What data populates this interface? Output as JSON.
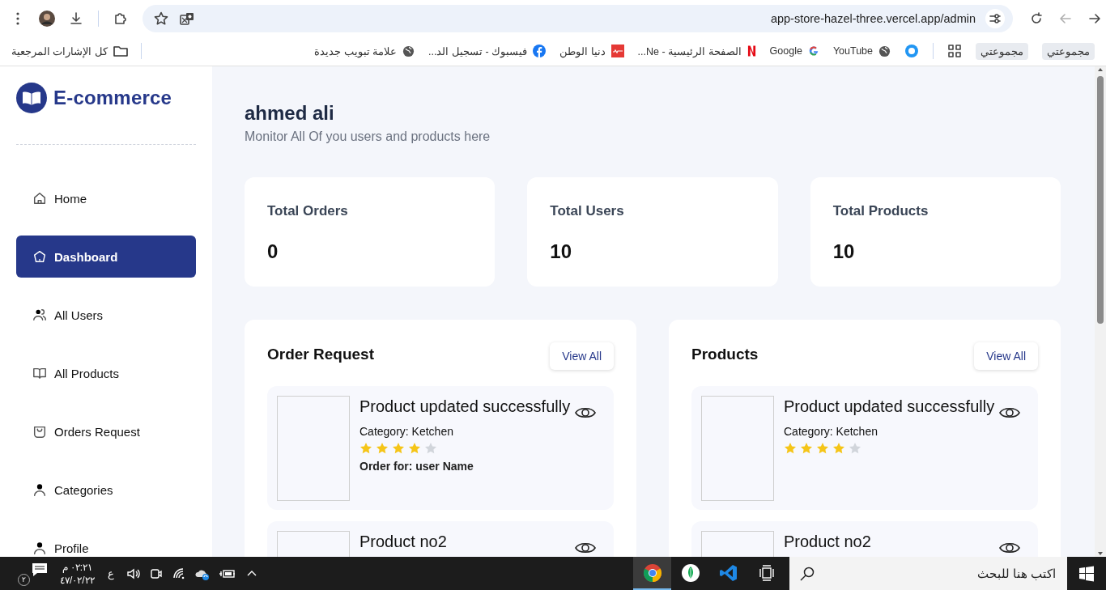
{
  "browser": {
    "address": "app-store-hazel-three.vercel.app/admin",
    "groups": [
      "مجموعتي",
      "مجموعتي"
    ],
    "bookmarks": [
      "YouTube",
      "Google",
      "الصفحة الرئيسية - Ne...",
      "دنيا الوطن",
      "فيسبوك - تسجيل الد...",
      "علامة تبويب جديدة"
    ],
    "all_bookmarks": "كل الإشارات المرجعية"
  },
  "sidebar": {
    "logo": "E-commerce",
    "items": [
      {
        "label": "Home",
        "selected": false
      },
      {
        "label": "Dashboard",
        "selected": true
      },
      {
        "label": "All Users",
        "selected": false
      },
      {
        "label": "All Products",
        "selected": false
      },
      {
        "label": "Orders Request",
        "selected": false
      },
      {
        "label": "Categories",
        "selected": false
      },
      {
        "label": "Profile",
        "selected": false
      }
    ]
  },
  "header": {
    "title": "ahmed ali",
    "subtitle": "Monitor All Of you users and products here"
  },
  "stats": [
    {
      "label": "Total Orders",
      "value": "0"
    },
    {
      "label": "Total Users",
      "value": "10"
    },
    {
      "label": "Total Products",
      "value": "10"
    }
  ],
  "panels": [
    {
      "title": "Order Request",
      "button": "View All",
      "items": [
        {
          "title": "Product updated successfully",
          "category": "Category: Ketchen",
          "stars": 4,
          "order_for": "Order for: user Name"
        },
        {
          "title": "Product no2"
        }
      ]
    },
    {
      "title": "Products",
      "button": "View All",
      "items": [
        {
          "title": "Product updated successfully",
          "category": "Category: Ketchen",
          "stars": 4
        },
        {
          "title": "Product no2"
        }
      ]
    }
  ],
  "taskbar": {
    "notifications": "٢",
    "time": "م ٠٢:٢١",
    "date": "٤٧/٠٢/٢٢",
    "language": "ع",
    "apps": [
      {
        "selected": true
      },
      {
        "selected": false
      },
      {
        "selected": false
      }
    ],
    "search": {
      "placeholder": "اكتب هنا للبحث"
    }
  }
}
